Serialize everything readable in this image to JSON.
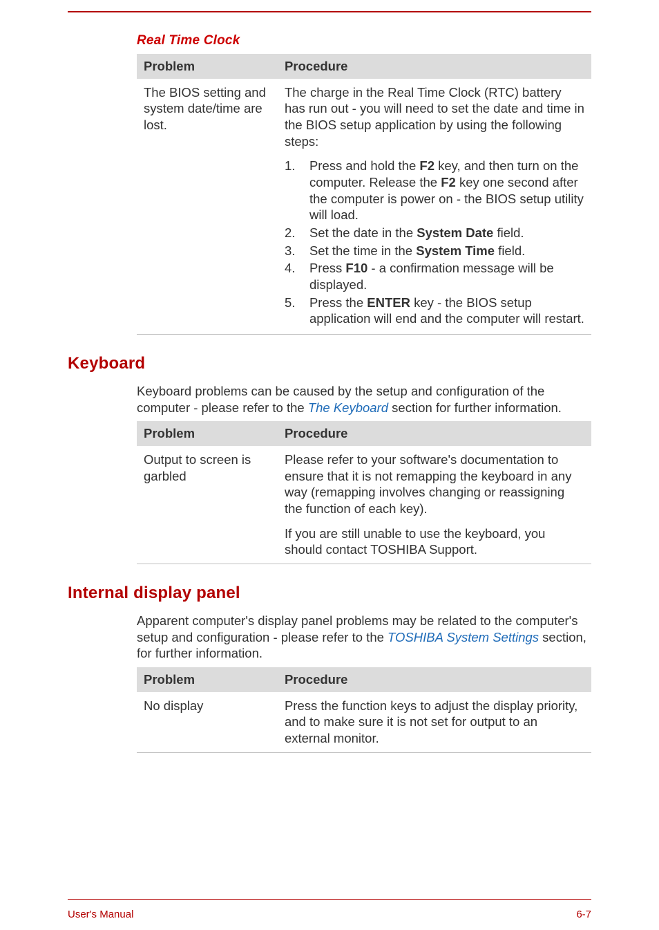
{
  "footer": {
    "left": "User's Manual",
    "right": "6-7"
  },
  "rtc": {
    "heading": "Real Time Clock",
    "col1": "Problem",
    "col2": "Procedure",
    "problem": "The BIOS setting and system date/time are lost.",
    "intro": "The charge in the Real Time Clock (RTC) battery has run out - you will need to set the date and time in the BIOS setup application by using the following steps:",
    "step1a": "Press and hold the ",
    "step1b": "F2",
    "step1c": " key, and then turn on the computer. Release the ",
    "step1d": "F2",
    "step1e": " key one second after the computer is power on - the BIOS setup utility will load.",
    "step2a": "Set the date in the ",
    "step2b": "System Date",
    "step2c": " field.",
    "step3a": "Set the time in the ",
    "step3b": "System Time",
    "step3c": " field.",
    "step4a": "Press ",
    "step4b": "F10",
    "step4c": " - a confirmation message will be displayed.",
    "step5a": "Press the ",
    "step5b": "ENTER",
    "step5c": " key - the BIOS setup application will end and the computer will restart."
  },
  "keyboard": {
    "heading": "Keyboard",
    "intro1": "Keyboard problems can be caused by the setup and configuration of the computer - please refer to the ",
    "link": "The Keyboard",
    "intro2": " section for further information.",
    "col1": "Problem",
    "col2": "Procedure",
    "problem": "Output to screen is garbled",
    "proc1": "Please refer to your software's documentation to ensure that it is not remapping the keyboard in any way (remapping involves changing or reassigning the function of each key).",
    "proc2": "If you are still unable to use the keyboard, you should contact TOSHIBA Support."
  },
  "display": {
    "heading": "Internal display panel",
    "intro1": "Apparent computer's display panel problems may be related to the computer's setup and configuration - please refer to the ",
    "link": "TOSHIBA System Settings",
    "intro2": " section, for further information.",
    "col1": "Problem",
    "col2": "Procedure",
    "problem": "No display",
    "proc": "Press the function keys to adjust the display priority, and to make sure it is not set for output to an external monitor."
  }
}
